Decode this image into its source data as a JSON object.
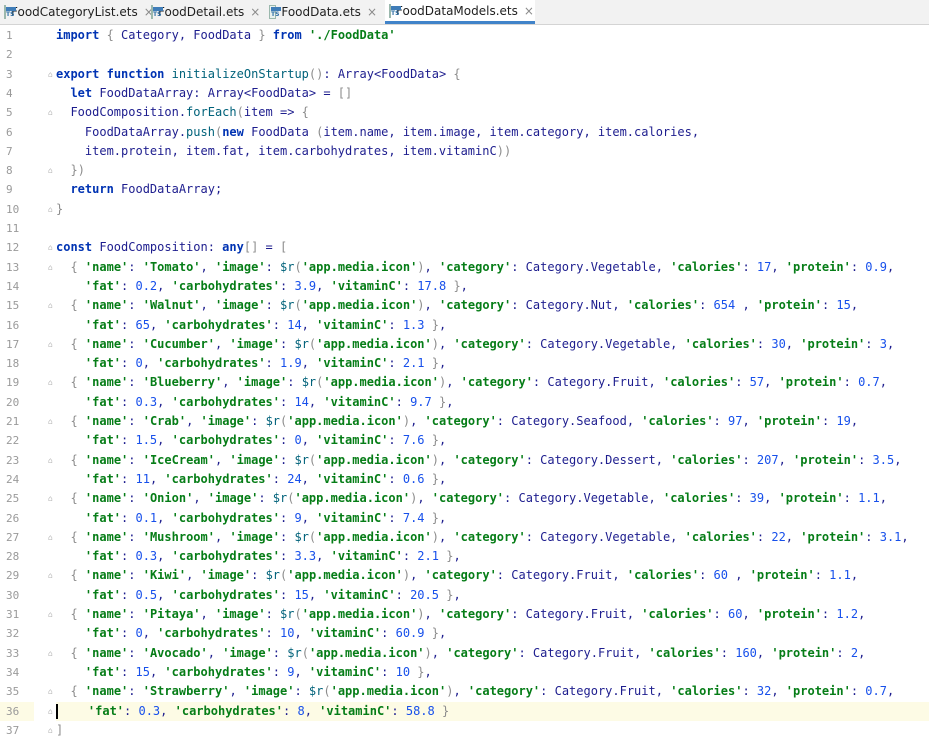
{
  "tabs": [
    {
      "label": "FoodCategoryList.ets",
      "active": false
    },
    {
      "label": "FoodDetail.ets",
      "active": false
    },
    {
      "label": "FoodData.ets",
      "active": false
    },
    {
      "label": "FoodDataModels.ets",
      "active": true
    }
  ],
  "icon_text": "TS",
  "close_glyph": "×",
  "current_line": 36,
  "lines": [
    "import { Category, FoodData } from './FoodData'",
    "",
    "export function initializeOnStartup(): Array<FoodData> {",
    "  let FoodDataArray: Array<FoodData> = []",
    "  FoodComposition.forEach(item => {",
    "    FoodDataArray.push(new FoodData (item.name, item.image, item.category, item.calories,",
    "    item.protein, item.fat, item.carbohydrates, item.vitaminC))",
    "  })",
    "  return FoodDataArray;",
    "}",
    "",
    "const FoodComposition: any[] = [",
    "  { 'name': 'Tomato', 'image': $r('app.media.icon'), 'category': Category.Vegetable, 'calories': 17, 'protein': 0.9,",
    "    'fat': 0.2, 'carbohydrates': 3.9, 'vitaminC': 17.8 },",
    "  { 'name': 'Walnut', 'image': $r('app.media.icon'), 'category': Category.Nut, 'calories': 654 , 'protein': 15,",
    "    'fat': 65, 'carbohydrates': 14, 'vitaminC': 1.3 },",
    "  { 'name': 'Cucumber', 'image': $r('app.media.icon'), 'category': Category.Vegetable, 'calories': 30, 'protein': 3,",
    "    'fat': 0, 'carbohydrates': 1.9, 'vitaminC': 2.1 },",
    "  { 'name': 'Blueberry', 'image': $r('app.media.icon'), 'category': Category.Fruit, 'calories': 57, 'protein': 0.7,",
    "    'fat': 0.3, 'carbohydrates': 14, 'vitaminC': 9.7 },",
    "  { 'name': 'Crab', 'image': $r('app.media.icon'), 'category': Category.Seafood, 'calories': 97, 'protein': 19,",
    "    'fat': 1.5, 'carbohydrates': 0, 'vitaminC': 7.6 },",
    "  { 'name': 'IceCream', 'image': $r('app.media.icon'), 'category': Category.Dessert, 'calories': 207, 'protein': 3.5,",
    "    'fat': 11, 'carbohydrates': 24, 'vitaminC': 0.6 },",
    "  { 'name': 'Onion', 'image': $r('app.media.icon'), 'category': Category.Vegetable, 'calories': 39, 'protein': 1.1,",
    "    'fat': 0.1, 'carbohydrates': 9, 'vitaminC': 7.4 },",
    "  { 'name': 'Mushroom', 'image': $r('app.media.icon'), 'category': Category.Vegetable, 'calories': 22, 'protein': 3.1,",
    "    'fat': 0.3, 'carbohydrates': 3.3, 'vitaminC': 2.1 },",
    "  { 'name': 'Kiwi', 'image': $r('app.media.icon'), 'category': Category.Fruit, 'calories': 60 , 'protein': 1.1,",
    "    'fat': 0.5, 'carbohydrates': 15, 'vitaminC': 20.5 },",
    "  { 'name': 'Pitaya', 'image': $r('app.media.icon'), 'category': Category.Fruit, 'calories': 60, 'protein': 1.2,",
    "    'fat': 0, 'carbohydrates': 10, 'vitaminC': 60.9 },",
    "  { 'name': 'Avocado', 'image': $r('app.media.icon'), 'category': Category.Fruit, 'calories': 160, 'protein': 2,",
    "    'fat': 15, 'carbohydrates': 9, 'vitaminC': 10 },",
    "  { 'name': 'Strawberry', 'image': $r('app.media.icon'), 'category': Category.Fruit, 'calories': 32, 'protein': 0.7,",
    "    'fat': 0.3, 'carbohydrates': 8, 'vitaminC': 58.8 }",
    "]"
  ],
  "line_numbers": [
    "1",
    "2",
    "3",
    "4",
    "5",
    "6",
    "7",
    "8",
    "9",
    "10",
    "11",
    "12",
    "13",
    "14",
    "15",
    "16",
    "17",
    "18",
    "19",
    "20",
    "21",
    "22",
    "23",
    "24",
    "25",
    "26",
    "27",
    "28",
    "29",
    "30",
    "31",
    "32",
    "33",
    "34",
    "35",
    "36",
    "37"
  ],
  "colors": {
    "keyword": "#0033b3",
    "string": "#067d17",
    "number": "#1750eb",
    "identifier": "#1d1d8e",
    "current_line_bg": "#fdfbe5",
    "active_tab_underline": "#4083c9"
  }
}
